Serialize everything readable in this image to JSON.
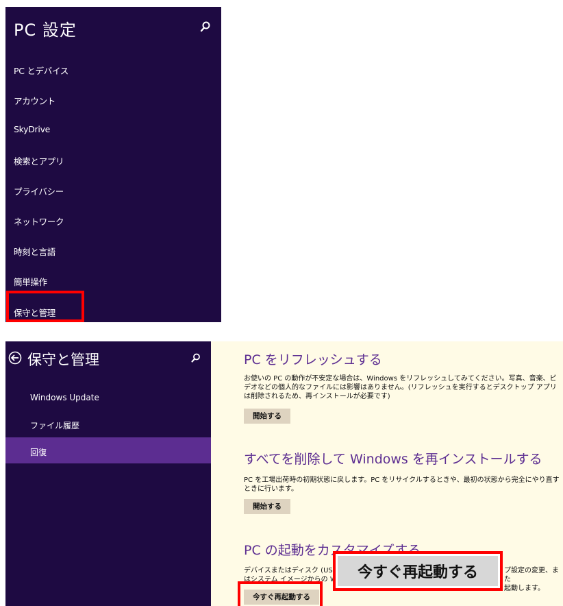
{
  "top": {
    "title": "PC 設定",
    "search_icon": "search-icon",
    "items": [
      {
        "label": "PC とデバイス"
      },
      {
        "label": "アカウント"
      },
      {
        "label": "SkyDrive"
      },
      {
        "label": "検索とアプリ"
      },
      {
        "label": "プライバシー"
      },
      {
        "label": "ネットワーク"
      },
      {
        "label": "時刻と言語"
      },
      {
        "label": "簡単操作"
      },
      {
        "label": "保守と管理"
      }
    ]
  },
  "bottom": {
    "title": "保守と管理",
    "back_icon": "back-arrow-icon",
    "search_icon": "search-icon",
    "items": [
      {
        "label": "Windows Update"
      },
      {
        "label": "ファイル履歴"
      },
      {
        "label": "回復"
      }
    ],
    "refresh": {
      "heading": "PC をリフレッシュする",
      "body": "お使いの PC の動作が不安定な場合は、Windows をリフレッシュしてみてください。写真、音楽、ビデオなどの個人的なファイルには影響はありません。(リフレッシュを実行するとデスクトップ アプリは削除されるため、再インストールが必要です)",
      "button": "開始する"
    },
    "reset": {
      "heading": "すべてを削除して Windows を再インストールする",
      "body": "PC を工場出荷時の初期状態に戻します。PC をリサイクルするときや、最初の状態から完全にやり直すときに行います。",
      "button": "開始する"
    },
    "startup": {
      "heading": "PC の起動をカスタマイズする",
      "body_left": "デバイスまたはディスク (USB",
      "body_left2": "はシステム イメージからの Wi",
      "body_right": "プ設定の変更、また",
      "body_right2": "起動します。",
      "button": "今すぐ再起動する"
    },
    "callout": "今すぐ再起動する"
  },
  "colors": {
    "sidebar_bg": "#1e0a42",
    "accent": "#5c2d91",
    "content_bg": "#fffbe6",
    "highlight": "#ff0000",
    "button_bg": "#ded3c0"
  }
}
